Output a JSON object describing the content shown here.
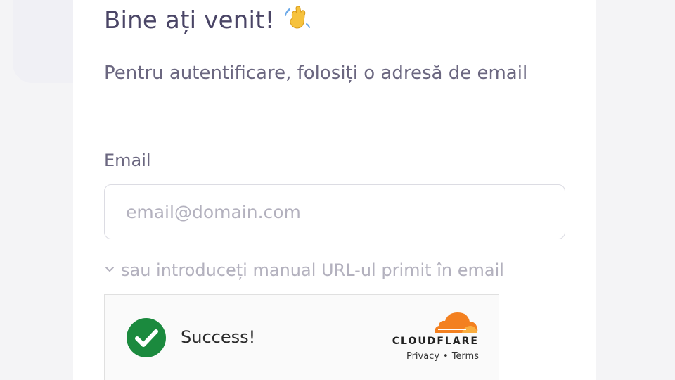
{
  "header": {
    "title": "Bine ați venit!",
    "title_icon": "waving-hand-icon"
  },
  "intro": {
    "text": "Pentru autentificare, folosiți o adresă de email"
  },
  "form": {
    "email_label": "Email",
    "email_value": "",
    "email_placeholder": "email@domain.com",
    "manual_url_text": "sau introduceți manual URL-ul primit în email",
    "manual_url_icon": "chevron-down-icon"
  },
  "captcha": {
    "status_text": "Success!",
    "status_icon": "check-circle-icon",
    "status_color": "#1b8a3e",
    "provider": "CLOUDFLARE",
    "provider_color": "#f38020",
    "privacy_link": "Privacy",
    "separator": "•",
    "terms_link": "Terms"
  },
  "colors": {
    "title": "#4a4566",
    "text": "#6b6780",
    "placeholder": "#b3b1be",
    "background": "#f4f4f6",
    "card": "#ffffff"
  }
}
